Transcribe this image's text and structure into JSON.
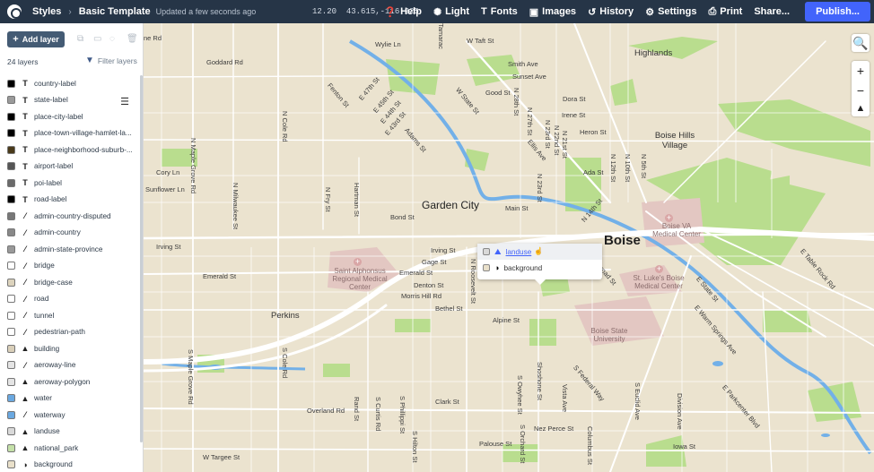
{
  "topbar": {
    "app": "Styles",
    "style_name": "Basic Template",
    "updated": "Updated a few seconds ago",
    "zoom": "12.20",
    "coordinates": "43.615,-116.225",
    "help": "Help",
    "light": "Light",
    "fonts": "Fonts",
    "images": "Images",
    "history": "History",
    "settings": "Settings",
    "print": "Print",
    "share": "Share...",
    "publish": "Publish...",
    "accent": "#4264fb"
  },
  "sidebar": {
    "add_layer": "Add layer",
    "layer_count": "24 layers",
    "filter": "Filter layers",
    "layers": [
      {
        "name": "country-label",
        "type": "symbol",
        "color": "#000000"
      },
      {
        "name": "state-label",
        "type": "symbol",
        "color": "#9a9a9a"
      },
      {
        "name": "place-city-label",
        "type": "symbol",
        "color": "#000000"
      },
      {
        "name": "place-town-village-hamlet-la...",
        "type": "symbol",
        "color": "#000000"
      },
      {
        "name": "place-neighborhood-suburb-...",
        "type": "symbol",
        "color": "#4a3a1a"
      },
      {
        "name": "airport-label",
        "type": "symbol",
        "color": "#555555"
      },
      {
        "name": "poi-label",
        "type": "symbol",
        "color": "#6a6a6a"
      },
      {
        "name": "road-label",
        "type": "symbol",
        "color": "#000000"
      },
      {
        "name": "admin-country-disputed",
        "type": "line",
        "color": "#777777"
      },
      {
        "name": "admin-country",
        "type": "line",
        "color": "#888888"
      },
      {
        "name": "admin-state-province",
        "type": "line",
        "color": "#999999"
      },
      {
        "name": "bridge",
        "type": "line",
        "color": "#ffffff"
      },
      {
        "name": "bridge-case",
        "type": "line",
        "color": "#dcd3bd"
      },
      {
        "name": "road",
        "type": "line",
        "color": "#ffffff"
      },
      {
        "name": "tunnel",
        "type": "line",
        "color": "#ffffff"
      },
      {
        "name": "pedestrian-path",
        "type": "line",
        "color": "#ffffff"
      },
      {
        "name": "building",
        "type": "fill",
        "color": "#d9cfb9"
      },
      {
        "name": "aeroway-line",
        "type": "line",
        "color": "#e4e4e4"
      },
      {
        "name": "aeroway-polygon",
        "type": "fill",
        "color": "#e4e4e4"
      },
      {
        "name": "water",
        "type": "fill",
        "color": "#6aa8e0"
      },
      {
        "name": "waterway",
        "type": "line",
        "color": "#6aa8e0"
      },
      {
        "name": "landuse",
        "type": "fill",
        "color": "#d9d9d9"
      },
      {
        "name": "national_park",
        "type": "fill",
        "color": "#c4e0a8"
      },
      {
        "name": "background",
        "type": "background",
        "color": "#e9e0ca"
      }
    ]
  },
  "popup": {
    "rows": [
      {
        "name": "landuse",
        "color": "#d9d9d9",
        "icon": "fill-icon"
      },
      {
        "name": "background",
        "color": "#e9e0ca",
        "icon": "background-icon"
      }
    ]
  },
  "map": {
    "labels": {
      "garden_city": "Garden City",
      "boise": "Boise",
      "highlands": "Highlands",
      "boise_hills_village": "Boise Hills Village",
      "perkins": "Perkins",
      "cory_ln": "Cory Ln",
      "sunflower_ln": "Sunflower Ln",
      "irving_st_w": "Irving St",
      "emerald_st_w": "Emerald St",
      "goddard_rd": "Goddard Rd",
      "wylie_ln": "Wylie Ln",
      "w_taft_st": "W Taft St",
      "smith_ave": "Smith Ave",
      "sunset_ave": "Sunset Ave",
      "good_st": "Good St",
      "dora_st": "Dora St",
      "irene_st": "Irene St",
      "heron_st": "Heron St",
      "ada_st": "Ada St",
      "bond_st": "Bond St",
      "main_st": "Main St",
      "irving_st": "Irving St",
      "gage_st": "Gage St",
      "emerald_st": "Emerald St",
      "denton_st": "Denton St",
      "morris_hill_rd": "Morris Hill Rd",
      "bethel_st": "Bethel St",
      "alpine_st": "Alpine St",
      "clark_st": "Clark St",
      "overland_rd": "Overland Rd",
      "nez_perce_st": "Nez Perce St",
      "palouse_st": "Palouse St",
      "w_targee_st": "W Targee St",
      "iowa_st": "Iowa St",
      "e_table_rock_rd": "E Table Rock Rd",
      "e_state_st": "E State St",
      "e_warm_springs_ave": "E Warm Springs Ave",
      "e_parkcenter_blvd": "E Parkcenter Blvd",
      "broad_st": "Broad St",
      "n_maple_grove_rd": "N Maple Grove Rd",
      "n_milwaukee_st": "N Milwaukee St",
      "n_cole_rd": "N Cole Rd",
      "n_fry_st": "N Fry St",
      "hartman_st": "Hartman St",
      "n_roosevelt_st": "N Roosevelt St",
      "s_maple_grove_rd": "S Maple Grove Rd",
      "s_cole_rd": "S Cole Rd",
      "s_curtis_rd": "S Curtis Rd",
      "s_phillippi_st": "S Phillippi St",
      "s_owyhee_st": "S Owyhee St",
      "shoshone_st": "Shoshone St",
      "vista_ave": "Vista Ave",
      "s_federal_way": "S Federal Way",
      "s_euclid_ave": "S Euclid Ave",
      "division_ave": "Division Ave",
      "columbus_st": "Columbus St",
      "rand_st": "Rand St",
      "s_hilton_st": "S Hilton St",
      "s_orchard_st": "S Orchard St",
      "w_state_st": "W State St",
      "n_28th_st": "N 28th St",
      "n_27th_st": "N 27th St",
      "n_23rd_st": "N 23rd St",
      "n_22nd_st": "N 22nd St",
      "n_21st_st": "N 21st St",
      "n_14th_st": "N 14th St",
      "n_12th_st": "N 12th St",
      "n_10th_st": "N 10th St",
      "n_5th_st": "N 5th St",
      "adams_st": "Adams St",
      "fenton_st": "Fenton St",
      "e_47th_st": "E 47th St",
      "e_45th_st": "E 45th St",
      "e_44th_st": "E 44th St",
      "e_43rd_st": "E 43rd St",
      "ellis_ave": "Ellis Ave",
      "n_23rd_st_b": "N 23rd St",
      "ne_rd": "ne Rd",
      "tamarack": "Tamarac",
      "saint_alphonsus": "Saint Alphonsus Regional Medical Center",
      "boise_va": "Boise VA Medical Center",
      "st_lukes": "St. Luke's Boise Medical Center",
      "boise_state": "Boise State University"
    }
  }
}
